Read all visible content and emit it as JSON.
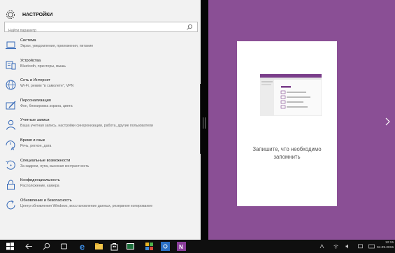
{
  "settings": {
    "title": "НАСТРОЙКИ",
    "search_placeholder": "Найти параметр",
    "items": [
      {
        "icon": "laptop-icon",
        "title": "Система",
        "desc": "Экран, уведомления, приложения, питание"
      },
      {
        "icon": "devices-icon",
        "title": "Устройства",
        "desc": "Bluetooth, принтеры, мышь"
      },
      {
        "icon": "globe-icon",
        "title": "Сеть и Интернет",
        "desc": "Wi-Fi, режим \"в самолете\", VPN"
      },
      {
        "icon": "personalization-icon",
        "title": "Персонализация",
        "desc": "Фон, блокировка экрана, цвета"
      },
      {
        "icon": "person-icon",
        "title": "Учетные записи",
        "desc": "Ваша учетная запись, настройки синхронизации, работа, другие пользователи"
      },
      {
        "icon": "time-language-icon",
        "title": "Время и язык",
        "desc": "Речь, регион, дата"
      },
      {
        "icon": "accessibility-icon",
        "title": "Специальные возможности",
        "desc": "За кадром, лупа, высокая контрастность"
      },
      {
        "icon": "lock-icon",
        "title": "Конфиденциальность",
        "desc": "Расположение, камера"
      },
      {
        "icon": "update-icon",
        "title": "Обновление и безопасность",
        "desc": "Центр обновления Windows, восстановление данных, резервное копирование"
      }
    ]
  },
  "onenote": {
    "caption_line1": "Запишите, что необходимо",
    "caption_line2": "запомнить",
    "accent": "#8a4f95"
  },
  "taskbar": {
    "time": "12:15",
    "date": "04.09.2015",
    "icons": [
      "windows-start-icon",
      "back-icon",
      "search-icon",
      "task-view-icon",
      "edge-icon",
      "explorer-icon",
      "store-icon",
      "xbox-icon",
      "settings-icon",
      "onenote-icon"
    ]
  }
}
